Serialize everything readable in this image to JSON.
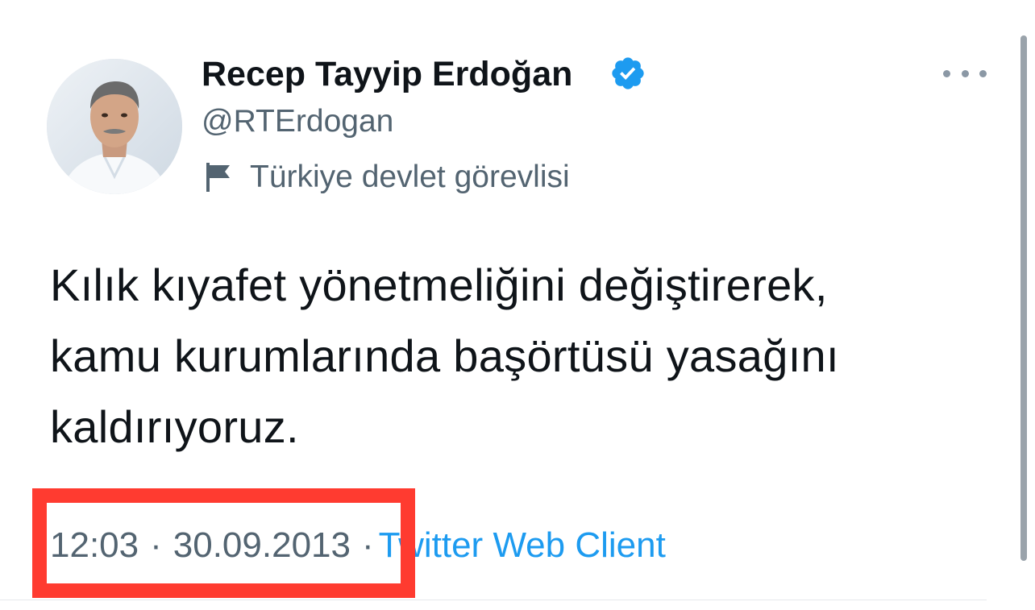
{
  "tweet": {
    "author": {
      "display_name": "Recep Tayyip Erdoğan",
      "handle": "@RTErdogan",
      "verified": true,
      "affiliation": "Türkiye devlet görevlisi",
      "avatar_icon": "profile-photo",
      "badge_icon": "verified-badge-icon",
      "affiliation_icon": "flag-icon"
    },
    "text_lines": [
      "Kılık kıyafet yönetmeliğini değiştirerek,",
      "kamu kurumlarında başörtüsü yasağını",
      "kaldırıyoruz."
    ],
    "time": "12:03",
    "separator": "·",
    "date": "30.09.2013",
    "source": "Twitter Web Client",
    "more_icon": "more-options-icon"
  },
  "colors": {
    "primary_text": "#0f1419",
    "secondary_text": "#536471",
    "link": "#1d9bf0",
    "verified": "#1d9bf0",
    "highlight": "#ff3b30"
  }
}
